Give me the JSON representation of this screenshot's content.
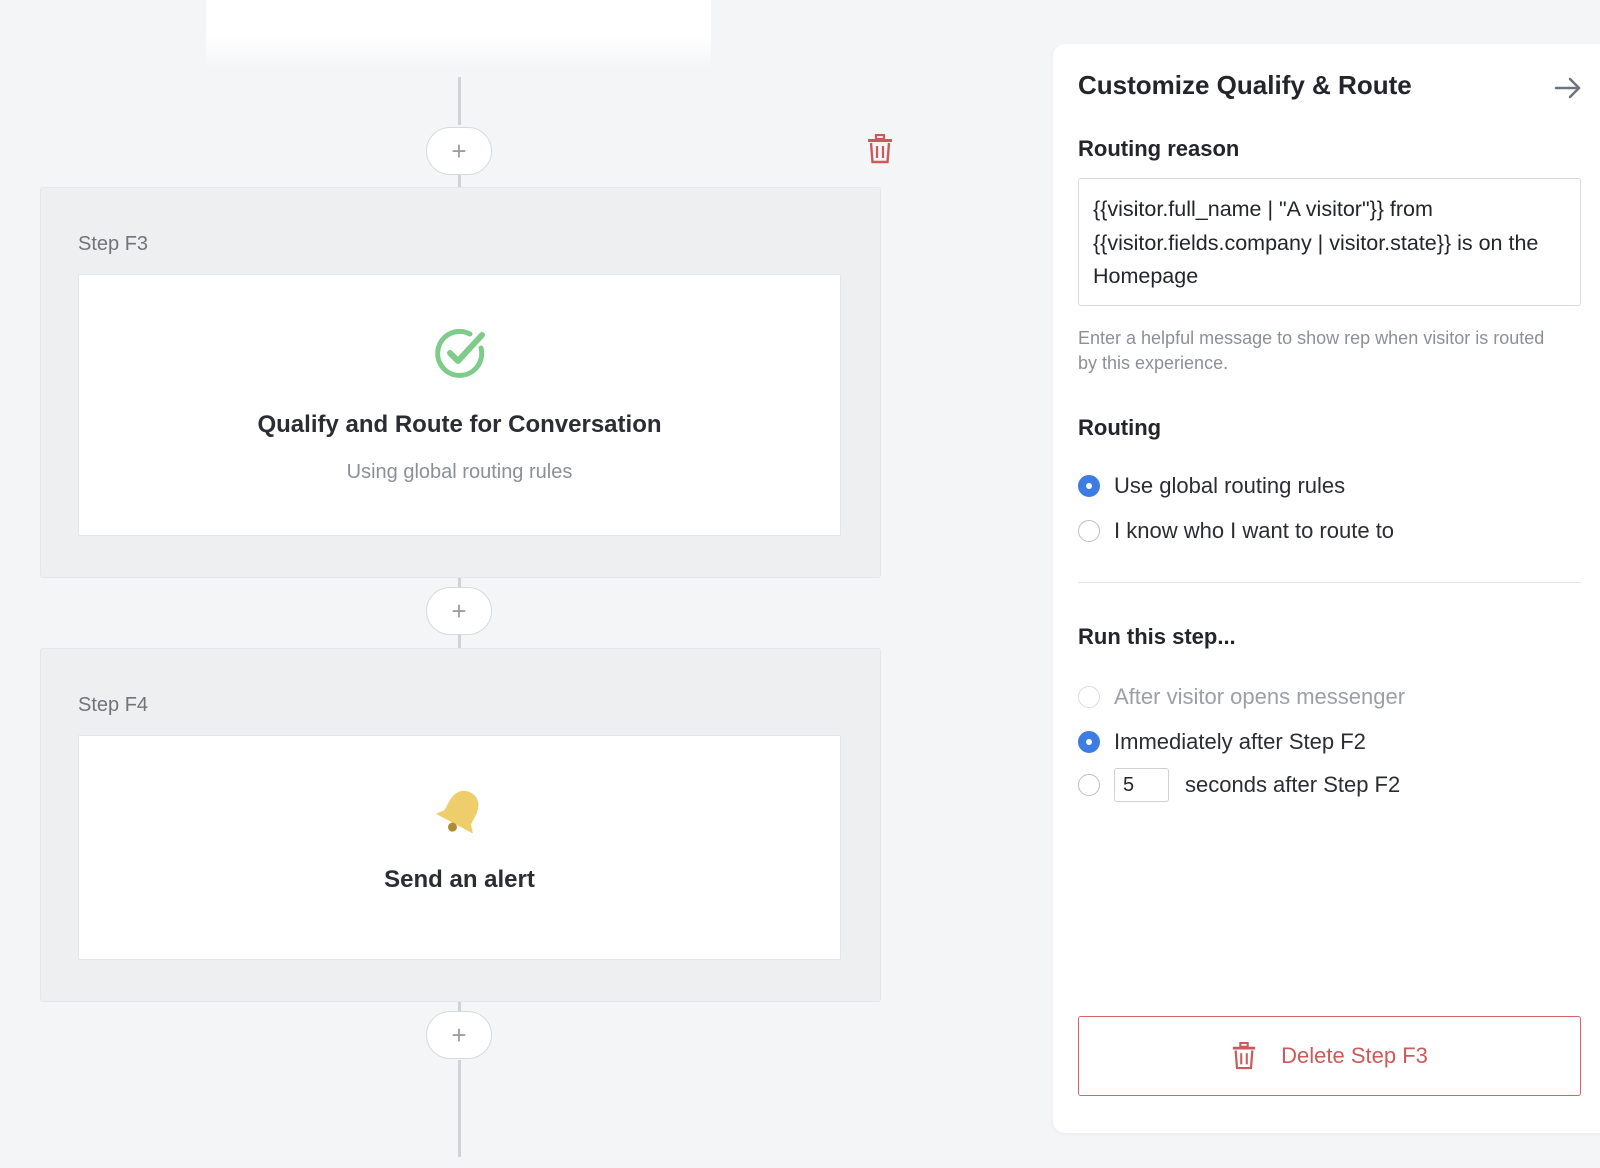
{
  "canvas": {
    "steps": [
      {
        "label": "Step F3",
        "card_title": "Qualify and Route for Conversation",
        "card_subtitle": "Using global routing rules",
        "icon": "check-circle-icon"
      },
      {
        "label": "Step F4",
        "card_title": "Send an alert",
        "icon": "bell-icon"
      }
    ],
    "add_label": "+"
  },
  "panel": {
    "title": "Customize Qualify & Route",
    "routing_reason": {
      "heading": "Routing reason",
      "value": "{{visitor.full_name | \"A visitor\"}} from {{visitor.fields.company | visitor.state}} is on the Homepage",
      "help": "Enter a helpful message to show rep when visitor is routed by this experience."
    },
    "routing": {
      "heading": "Routing",
      "options": [
        {
          "label": "Use global routing rules",
          "selected": true
        },
        {
          "label": "I know who I want to route to",
          "selected": false
        }
      ]
    },
    "run_step": {
      "heading": "Run this step...",
      "options": [
        {
          "label": "After visitor opens messenger",
          "selected": false,
          "disabled": true
        },
        {
          "label": "Immediately after Step F2",
          "selected": true
        },
        {
          "label": "seconds after Step F2",
          "selected": false,
          "seconds": "5"
        }
      ]
    },
    "delete_label": "Delete Step F3"
  },
  "colors": {
    "accent": "#3d7ce4",
    "danger": "#cc5a5a",
    "success": "#7ecb8a",
    "bell": "#edce6a"
  }
}
